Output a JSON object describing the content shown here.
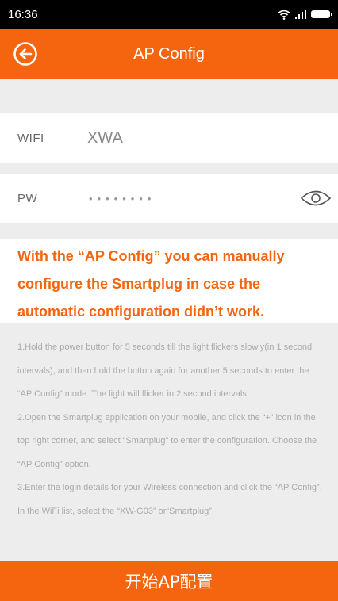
{
  "status_bar": {
    "time": "16:36",
    "wifi_icon": "wifi-icon",
    "signal_icon": "signal-icon",
    "battery_icon": "battery-icon"
  },
  "app_bar": {
    "title": "AP Config",
    "back_icon": "back-arrow-circle-icon"
  },
  "wifi_row": {
    "label": "WIFI",
    "value": "XWA"
  },
  "pw_row": {
    "label": "PW",
    "value": "••••••••",
    "toggle_icon": "eye-icon"
  },
  "intro": {
    "text": "With the “AP Config” you can manually configure the Smartplug in case the automatic configuration didn’t work."
  },
  "instructions": [
    "1.Hold the power button for 5 seconds till the light flickers slowly(in 1 second intervals), and then hold the button again for another 5 seconds to enter the “AP Config” mode. The light will flicker in 2 second intervals.",
    "2.Open the Smartplug application on your mobile, and click the “+” icon in the top right corner, and select “Smartplug” to enter the configuration. Choose the “AP Config” option.",
    "3.Enter the login details for your Wireless connection and click the “AP Config”. In the WiFi list, select the “XW-G03” or“Smartplug”."
  ],
  "start_button": {
    "label": "开始AP配置"
  },
  "colors": {
    "accent": "#f5650f",
    "background": "#ededed",
    "status_bar": "#000000",
    "instruction_text": "#aaaaaa"
  }
}
